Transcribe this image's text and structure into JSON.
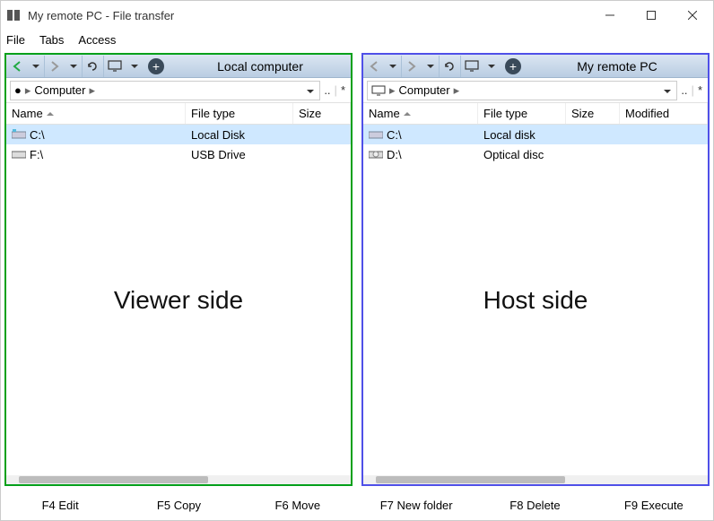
{
  "window": {
    "title": "My remote PC - File transfer"
  },
  "menu": {
    "file": "File",
    "tabs": "Tabs",
    "access": "Access"
  },
  "local": {
    "title": "Local computer",
    "breadcrumb": {
      "root": "Computer",
      "up": "..",
      "sep": "|",
      "star": "*"
    },
    "columns": {
      "name": "Name",
      "filetype": "File type",
      "size": "Size"
    },
    "rows": [
      {
        "name": "C:\\",
        "filetype": "Local Disk",
        "selected": true
      },
      {
        "name": "F:\\",
        "filetype": "USB Drive",
        "selected": false
      }
    ],
    "watermark": "Viewer side"
  },
  "host": {
    "title": "My remote PC",
    "breadcrumb": {
      "root": "Computer",
      "up": "..",
      "sep": "|",
      "star": "*"
    },
    "columns": {
      "name": "Name",
      "filetype": "File type",
      "size": "Size",
      "modified": "Modified"
    },
    "rows": [
      {
        "name": "C:\\",
        "filetype": "Local disk",
        "selected": true
      },
      {
        "name": "D:\\",
        "filetype": "Optical disc",
        "selected": false
      }
    ],
    "watermark": "Host side"
  },
  "footer": {
    "f4": "F4 Edit",
    "f5": "F5 Copy",
    "f6": "F6 Move",
    "f7": "F7 New folder",
    "f8": "F8 Delete",
    "f9": "F9 Execute"
  }
}
